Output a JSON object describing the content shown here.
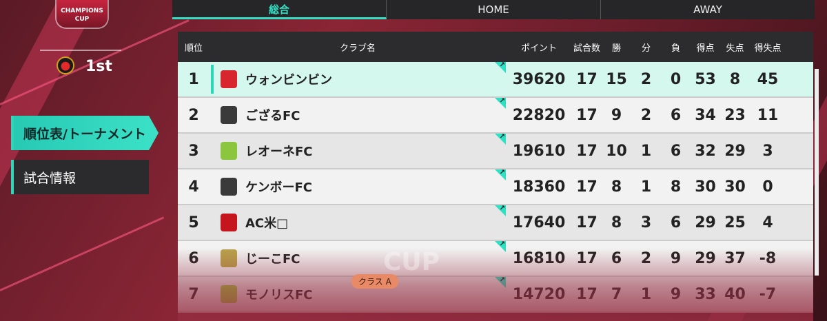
{
  "logo": {
    "line1": "CHAMPIONS",
    "line2": "CUP"
  },
  "rank": {
    "text": "1st"
  },
  "menu": [
    {
      "label": "順位表/トーナメント",
      "active": true
    },
    {
      "label": "試合情報",
      "active": false
    }
  ],
  "tabs": [
    {
      "label": "総合",
      "active": true
    },
    {
      "label": "HOME",
      "active": false
    },
    {
      "label": "AWAY",
      "active": false
    }
  ],
  "table": {
    "headers": {
      "pos": "順位",
      "club": "クラブ名",
      "pts": "ポイント",
      "played": "試合数",
      "won": "勝",
      "drawn": "分",
      "lost": "負",
      "gf": "得点",
      "ga": "失点",
      "gd": "得失点"
    },
    "rows": [
      {
        "pos": "1",
        "club": "ウォンビンビン",
        "pts": "39620",
        "played": "17",
        "won": "15",
        "drawn": "2",
        "lost": "0",
        "gf": "53",
        "ga": "8",
        "gd": "45",
        "crest_color": "#d8262e"
      },
      {
        "pos": "2",
        "club": "ござるFC",
        "pts": "22820",
        "played": "17",
        "won": "9",
        "drawn": "2",
        "lost": "6",
        "gf": "34",
        "ga": "23",
        "gd": "11",
        "crest_color": "#3a3a3a"
      },
      {
        "pos": "3",
        "club": "レオーネFC",
        "pts": "19610",
        "played": "17",
        "won": "10",
        "drawn": "1",
        "lost": "6",
        "gf": "32",
        "ga": "29",
        "gd": "3",
        "crest_color": "#8cc63f"
      },
      {
        "pos": "4",
        "club": "ケンボーFC",
        "pts": "18360",
        "played": "17",
        "won": "8",
        "drawn": "1",
        "lost": "8",
        "gf": "30",
        "ga": "30",
        "gd": "0",
        "crest_color": "#3a3a3a"
      },
      {
        "pos": "5",
        "club": "AC米□",
        "pts": "17640",
        "played": "17",
        "won": "8",
        "drawn": "3",
        "lost": "6",
        "gf": "29",
        "ga": "25",
        "gd": "4",
        "crest_color": "#c4161c"
      },
      {
        "pos": "6",
        "club": "じーこFC",
        "pts": "16810",
        "played": "17",
        "won": "6",
        "drawn": "2",
        "lost": "9",
        "gf": "29",
        "ga": "37",
        "gd": "-8",
        "crest_color": "#b8a24a"
      },
      {
        "pos": "7",
        "club": "モノリスFC",
        "pts": "14720",
        "played": "17",
        "won": "7",
        "drawn": "1",
        "lost": "9",
        "gf": "33",
        "ga": "40",
        "gd": "-7",
        "crest_color": "#9ccc3a"
      }
    ]
  },
  "class_badge": "クラス A",
  "watermark": "CUP",
  "arrow_glyph": "↗",
  "colors": {
    "accent": "#2fe0c4",
    "highlight_row": "#d4f7ee",
    "brand": "#c7253f"
  }
}
